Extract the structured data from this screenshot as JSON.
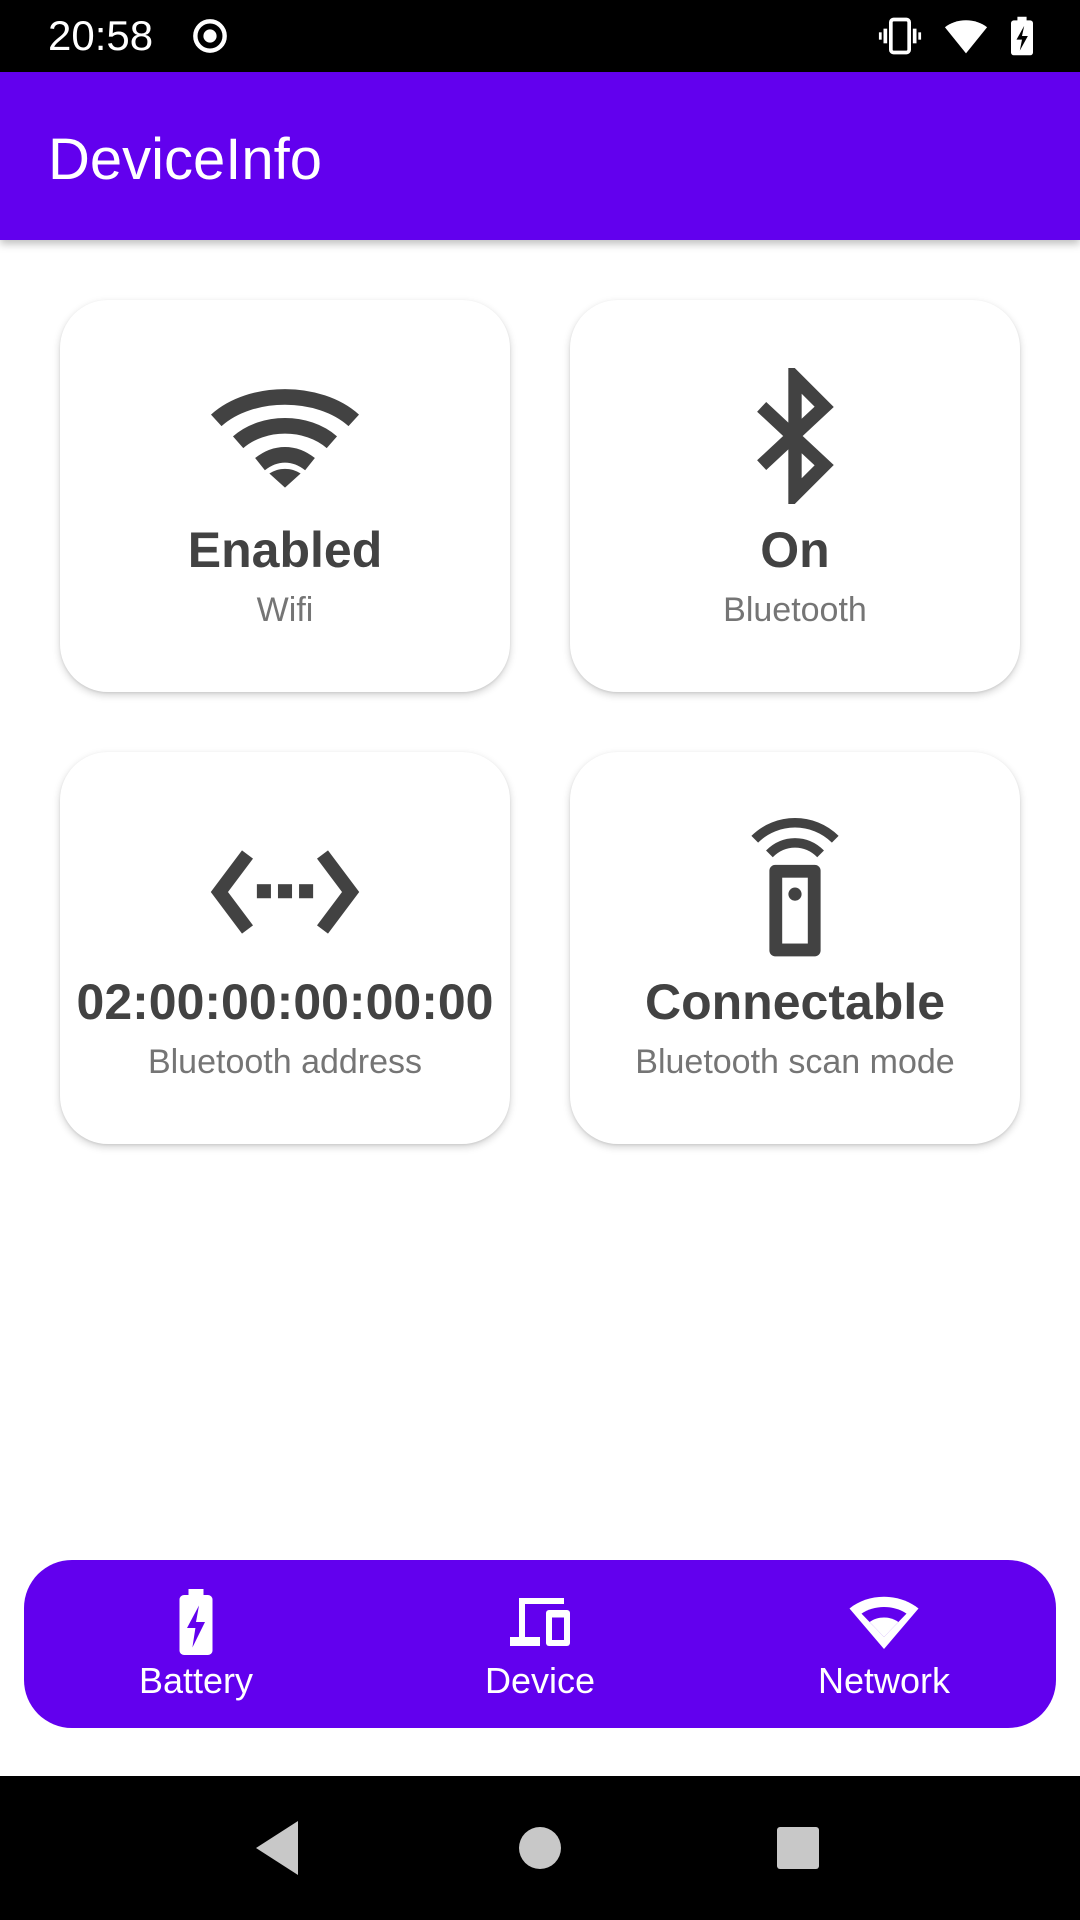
{
  "status_bar": {
    "time": "20:58",
    "icons": [
      "record-icon",
      "vibrate-icon",
      "wifi-icon",
      "battery-charging-icon"
    ]
  },
  "app_bar": {
    "title": "DeviceInfo",
    "background_color": "#6200EE"
  },
  "cards": [
    {
      "icon": "wifi-icon",
      "value": "Enabled",
      "label": "Wifi"
    },
    {
      "icon": "bluetooth-icon",
      "value": "On",
      "label": "Bluetooth"
    },
    {
      "icon": "settings-ethernet-icon",
      "value": "02:00:00:00:00:00",
      "label": "Bluetooth address"
    },
    {
      "icon": "settings-remote-icon",
      "value": "Connectable",
      "label": "Bluetooth scan mode"
    }
  ],
  "bottom_nav": {
    "items": [
      {
        "icon": "battery-charging-icon",
        "label": "Battery"
      },
      {
        "icon": "devices-icon",
        "label": "Device"
      },
      {
        "icon": "wifi-icon",
        "label": "Network",
        "selected": true
      }
    ]
  },
  "system_nav": {
    "buttons": [
      "back-icon",
      "home-icon",
      "recents-icon"
    ]
  }
}
